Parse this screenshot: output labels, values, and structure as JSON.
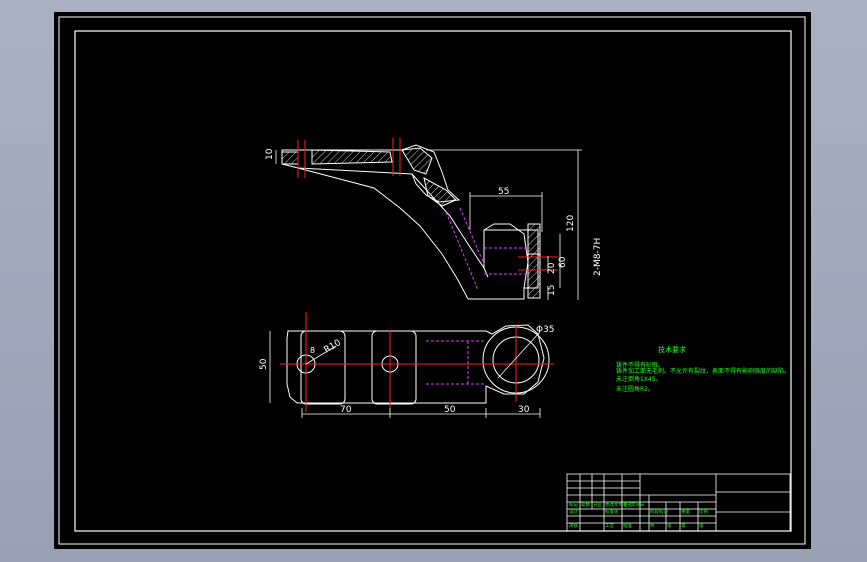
{
  "dimensions": {
    "top_thickness": "10",
    "top_width": "55",
    "total_height": "120",
    "bore_depth": "60",
    "step_height": "20",
    "base_height": "15",
    "thread_spec": "2-M8-7H",
    "plan_height": "50",
    "hole_radius": "R10",
    "span_left": "70",
    "span_mid": "50",
    "span_right": "30",
    "bore_diameter": "Φ35",
    "small_offset": "8"
  },
  "tech_requirements": {
    "title": "技术要求",
    "items": [
      "铸件不得有砂眼。",
      "铸件加工面无毛刺。不允许有裂纹，表面不得有影响强度的缺陷。",
      "未注倒角1X45。",
      "未注圆角R2。"
    ]
  },
  "title_block": {
    "labels": [
      "标记",
      "处数",
      "分区",
      "更改文件号",
      "签名",
      "年月日",
      "设计",
      "标准化",
      "阶段标记",
      "重量",
      "比例",
      "审核",
      "工艺",
      "批准",
      "共",
      "张",
      "第",
      "张"
    ]
  },
  "colors": {
    "background": "#000000",
    "outline": "#ffffff",
    "centerline": "#ff2020",
    "hidden": "#e040ff",
    "annotation": "#22ff22",
    "desktop": "#a4adbf"
  }
}
